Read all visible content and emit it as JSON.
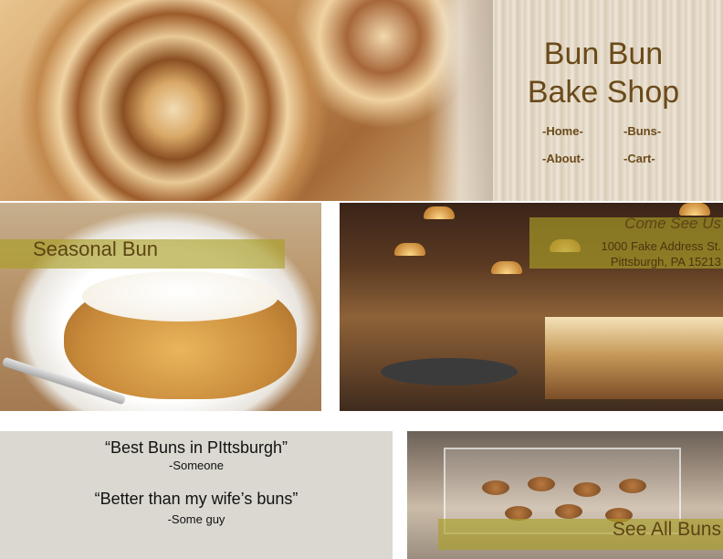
{
  "header": {
    "title_line1": "Bun Bun",
    "title_line2": "Bake Shop",
    "nav": {
      "home": "-Home-",
      "buns": "-Buns-",
      "about": "-About-",
      "cart": "-Cart-"
    }
  },
  "seasonal": {
    "label": "Seasonal Bun"
  },
  "location": {
    "heading": "Come See Us",
    "address_line1": "1000 Fake Address St.",
    "address_line2": "Pittsburgh, PA 15213"
  },
  "testimonials": [
    {
      "quote": "“Best Buns in PIttsburgh”",
      "author": "-Someone"
    },
    {
      "quote": "“Better than my wife’s buns”",
      "author": "-Some guy"
    }
  ],
  "see_all": {
    "label": "See All Buns"
  },
  "colors": {
    "title_brown": "#6b4a1a",
    "caption_band": "#aaa028",
    "testimonial_bg": "#dbd8d1"
  }
}
